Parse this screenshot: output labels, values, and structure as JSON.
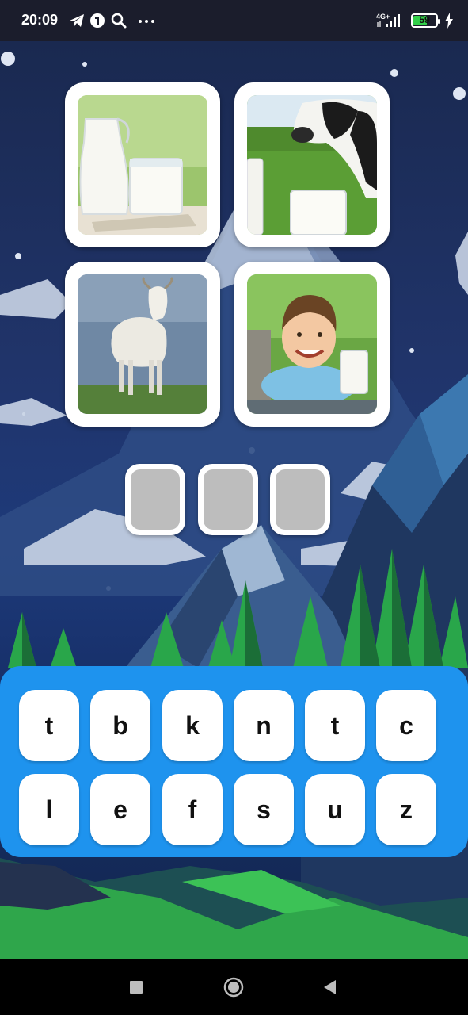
{
  "status_bar": {
    "time": "20:09",
    "network": "4G+",
    "battery": 59,
    "battery_color": "#33d04a"
  },
  "puzzle": {
    "pictures": [
      {
        "name": "milk-jug-and-glass",
        "icon": "milk-jug-icon"
      },
      {
        "name": "cow-with-milk",
        "icon": "cow-icon"
      },
      {
        "name": "goat",
        "icon": "goat-icon"
      },
      {
        "name": "boy-with-milk",
        "icon": "boy-icon"
      }
    ],
    "answer_slots": [
      "",
      "",
      ""
    ]
  },
  "keyboard": {
    "color": "#1e93ee",
    "rows": [
      [
        "t",
        "b",
        "k",
        "n",
        "t",
        "c"
      ],
      [
        "l",
        "e",
        "f",
        "s",
        "u",
        "z"
      ]
    ]
  },
  "nav_bar": {
    "buttons": [
      "recents-icon",
      "home-icon",
      "back-icon"
    ]
  }
}
